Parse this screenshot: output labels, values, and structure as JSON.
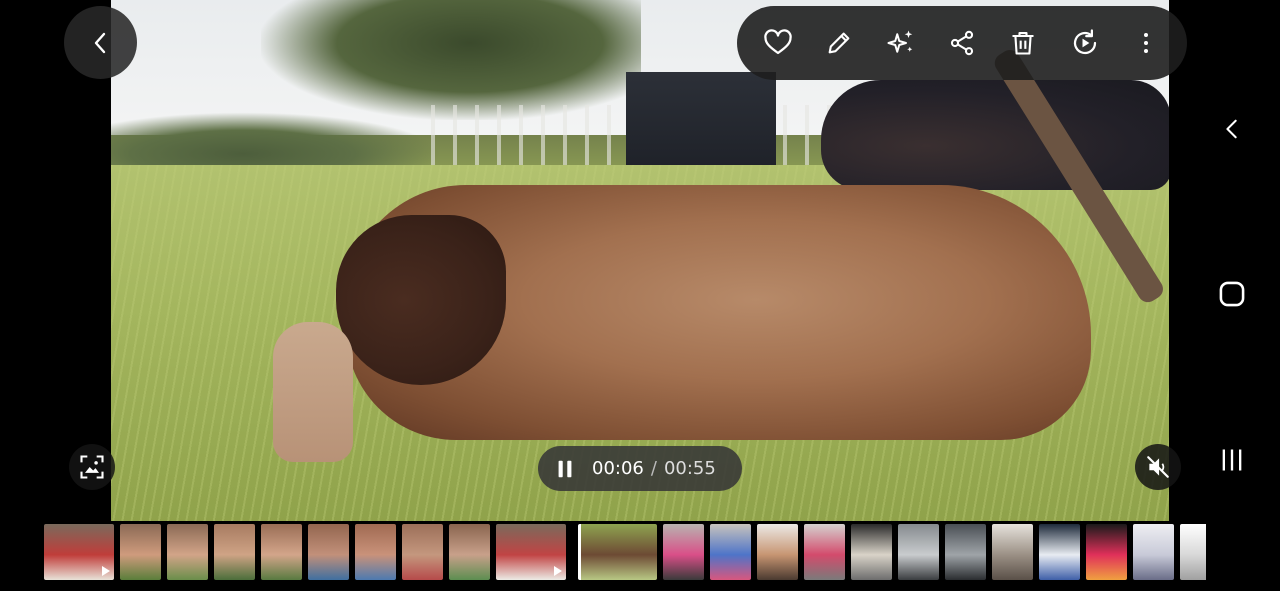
{
  "toolbar": {
    "icons": [
      "heart-icon",
      "edit-icon",
      "sparkle-effects-icon",
      "share-icon",
      "delete-icon",
      "rotate-icon",
      "more-options-icon"
    ]
  },
  "player": {
    "current_time": "00:06",
    "separator": "/",
    "total_time": "00:55",
    "state": "playing"
  },
  "colors": {
    "overlay_bg": "#282828",
    "icon_color": "#ffffff"
  },
  "navbar": {
    "icons": [
      "back-chevron-icon",
      "home-icon",
      "recent-apps-icon"
    ]
  },
  "thumbnails": [
    {
      "kind": "video",
      "palette": [
        "#7a6a5c",
        "#c03d3a",
        "#e8e2d8"
      ]
    },
    {
      "kind": "photo",
      "palette": [
        "#8b6a55",
        "#cf9b7d",
        "#5a7e3a"
      ]
    },
    {
      "kind": "photo",
      "palette": [
        "#8b6a55",
        "#d2a488",
        "#6a8e4a"
      ]
    },
    {
      "kind": "photo",
      "palette": [
        "#a77b61",
        "#cfa385",
        "#4b6e3a"
      ]
    },
    {
      "kind": "photo",
      "palette": [
        "#9a6e56",
        "#d3a58a",
        "#587a40"
      ]
    },
    {
      "kind": "photo",
      "palette": [
        "#93664f",
        "#c2907a",
        "#3f6fa0"
      ]
    },
    {
      "kind": "photo",
      "palette": [
        "#a06a52",
        "#c9927a",
        "#4d7ab0"
      ]
    },
    {
      "kind": "photo",
      "palette": [
        "#9c6f59",
        "#c4977e",
        "#b64a4a"
      ]
    },
    {
      "kind": "photo",
      "palette": [
        "#8a654f",
        "#c8a08a",
        "#5c8e50"
      ]
    },
    {
      "kind": "video",
      "palette": [
        "#7a6a5c",
        "#c14444",
        "#ecebe5"
      ]
    },
    {
      "kind": "current",
      "palette": [
        "#8ea350",
        "#6d4a34",
        "#b8c784"
      ]
    },
    {
      "kind": "photo",
      "palette": [
        "#b8b3b0",
        "#d94f88",
        "#3a3a3a"
      ]
    },
    {
      "kind": "photo",
      "palette": [
        "#c8c3bd",
        "#4e74c8",
        "#d8577e"
      ]
    },
    {
      "kind": "photo",
      "palette": [
        "#ece9e6",
        "#c79572",
        "#4b3a30"
      ]
    },
    {
      "kind": "photo",
      "palette": [
        "#d5d2cf",
        "#d34b6c",
        "#7a7a7a"
      ]
    },
    {
      "kind": "photo",
      "palette": [
        "#2a2a2a",
        "#d9d3c8",
        "#6d6d6d"
      ]
    },
    {
      "kind": "photo",
      "palette": [
        "#858a8e",
        "#c9ccce",
        "#3a3d40"
      ]
    },
    {
      "kind": "photo",
      "palette": [
        "#4a4f55",
        "#9fa4a8",
        "#2a2d30"
      ]
    },
    {
      "kind": "photo",
      "palette": [
        "#e6e2dc",
        "#9b9085",
        "#5a5048"
      ]
    },
    {
      "kind": "photo",
      "palette": [
        "#1e2a3a",
        "#e8ecf2",
        "#3e5fa8"
      ]
    },
    {
      "kind": "photo",
      "palette": [
        "#1a1a1a",
        "#e0305a",
        "#f0a040"
      ]
    },
    {
      "kind": "photo",
      "palette": [
        "#eeeef2",
        "#c8cad8",
        "#6a6d88"
      ]
    },
    {
      "kind": "photo",
      "palette": [
        "#ffffff",
        "#d8d8d8",
        "#a0a0a0"
      ]
    }
  ]
}
